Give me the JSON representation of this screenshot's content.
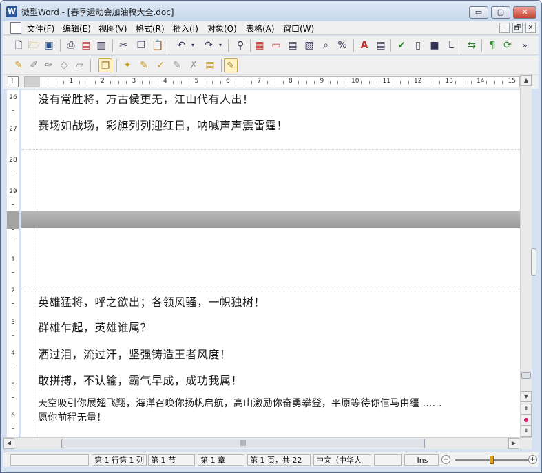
{
  "window": {
    "app_icon": "W",
    "title": "微型Word - [春季运动会加油稿大全.doc]",
    "minimize_glyph": "▭",
    "maximize_glyph": "▢",
    "close_glyph": "✕"
  },
  "menubar": {
    "items": [
      "文件(F)",
      "编辑(E)",
      "视图(V)",
      "格式(R)",
      "插入(I)",
      "对象(O)",
      "表格(A)",
      "窗口(W)"
    ],
    "mdi_minimize": "–",
    "mdi_restore": "🗗",
    "mdi_close": "✕"
  },
  "toolbar1": {
    "icons": [
      "new-doc-icon",
      "open-folder-icon",
      "save-icon",
      "print-icon",
      "pdf-icon",
      "print-preview-icon",
      "cut-icon",
      "copy-icon",
      "paste-icon",
      "undo-icon",
      "redo-icon",
      "find-icon",
      "table-insert-icon",
      "frame-icon",
      "columns-icon",
      "image-icon",
      "zoom-icon",
      "percent-icon",
      "font-color-icon",
      "bordered-icon",
      "spellcheck-icon",
      "chart-icon",
      "shape-icon",
      "layout-icon",
      "navigate-icon",
      "paragraph-mark-icon",
      "track-icon"
    ],
    "overflow_glyph": "»"
  },
  "toolbar2": {
    "icons": [
      "macro-icon",
      "edit-macro-icon",
      "macro-a-icon",
      "macro-b-icon",
      "macro-c-icon",
      "active-tool-icon",
      "star-pen-icon",
      "pen-icon",
      "pen-check-icon",
      "pen-erase-icon",
      "pen-clear-icon",
      "notepad-icon",
      "review-icon"
    ]
  },
  "tab_selector": "L",
  "ruler": {
    "numbers": [
      "1",
      "2",
      "3",
      "4",
      "5",
      "6",
      "7",
      "8",
      "9",
      "10",
      "11",
      "12",
      "13",
      "14",
      "15"
    ]
  },
  "vertical_ruler": {
    "page1_numbers": [
      "26",
      "27",
      "28",
      "29"
    ],
    "page2_numbers": [
      "0",
      "1",
      "2",
      "3",
      "4",
      "5",
      "6"
    ]
  },
  "document": {
    "page1_lines": [
      "没有常胜将，万古侯更无，江山代有人出！",
      "赛场如战场，彩旗列列迎红日，呐喊声声震雷霆！"
    ],
    "page2_lines": [
      "英雄猛将，呼之欲出；各领风骚，一帜独树！",
      "群雄乍起，英雄谁属？",
      "洒过泪，流过汗，坚强铸造王者风度！",
      "敢拼搏，不认输，霸气早成，成功我属！"
    ],
    "small_line_1": "天空吸引你展翅飞翔，海洋召唤你扬帆启航，高山激励你奋勇攀登，平原等待你信马由缰 ……",
    "small_line_2": "愿你前程无量！"
  },
  "scrollbars": {
    "up_glyph": "▲",
    "down_glyph": "▼",
    "prev_page_glyph": "⇞",
    "next_page_glyph": "⇟",
    "browse_glyph": "●",
    "left_glyph": "◀",
    "right_glyph": "▶",
    "thumb_grip": "|||"
  },
  "statusbar": {
    "position": "第 1 行第 1 列",
    "section": "第 1 节",
    "chapter": "第 1 章",
    "page": "第 1 页，共 22",
    "language": "中文（中华人",
    "mode": "Ins",
    "zoom_out": "−",
    "zoom_in": "+"
  },
  "colors": {
    "title_bar": "#c7d7ec",
    "page_gap": "#a3a3a3",
    "close_button": "#c7432f"
  }
}
